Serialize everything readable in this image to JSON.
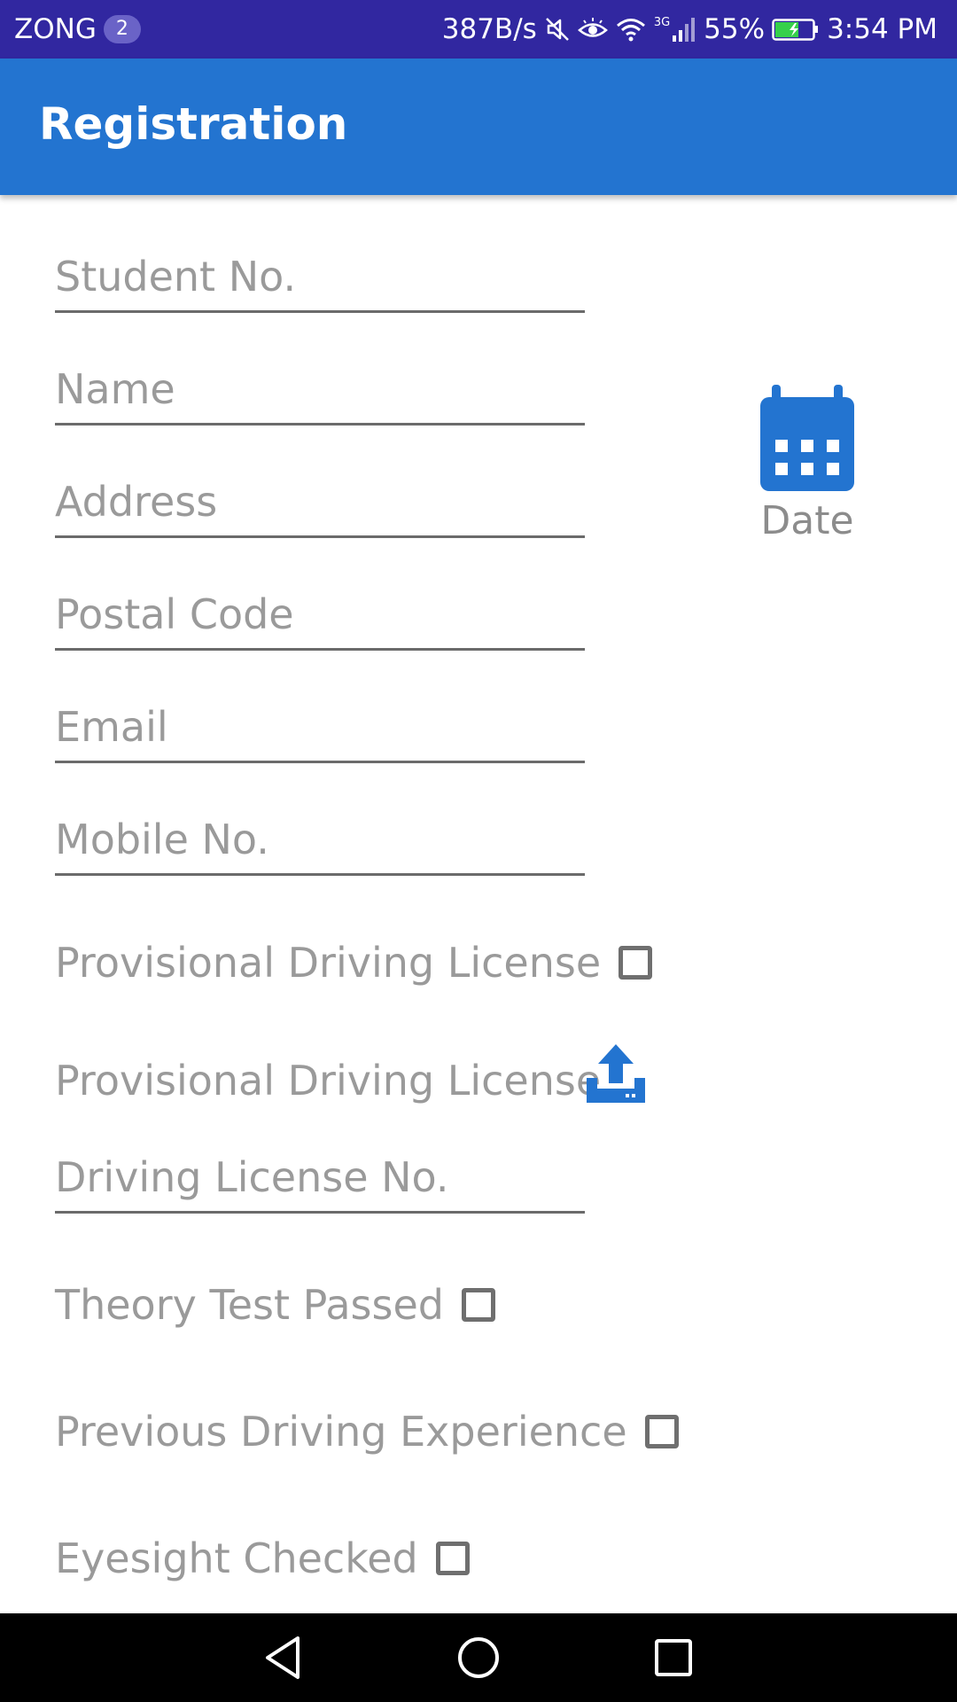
{
  "status_bar": {
    "carrier": "ZONG",
    "sim_slot": "2",
    "net_speed": "387B/s",
    "network_type": "3G",
    "battery": "55%",
    "time": "3:54 PM",
    "icons": [
      "mute-icon",
      "eye-comfort-icon",
      "wifi-icon",
      "signal-icon",
      "battery-charging-icon"
    ]
  },
  "app_bar": {
    "title": "Registration"
  },
  "form": {
    "student_no": {
      "placeholder": "Student No.",
      "value": ""
    },
    "name": {
      "placeholder": "Name",
      "value": ""
    },
    "address": {
      "placeholder": "Address",
      "value": ""
    },
    "postal_code": {
      "placeholder": "Postal Code",
      "value": ""
    },
    "email": {
      "placeholder": "Email",
      "value": ""
    },
    "mobile_no": {
      "placeholder": "Mobile No.",
      "value": ""
    },
    "provisional_license_check": {
      "label": "Provisional Driving License",
      "checked": false
    },
    "provisional_license_upload": {
      "label": "Provisional Driving License",
      "icon": "upload-icon"
    },
    "driving_license_no": {
      "placeholder": "Driving License No.",
      "value": ""
    },
    "theory_test": {
      "label": "Theory Test Passed",
      "checked": false
    },
    "previous_experience": {
      "label": "Previous Driving Experience",
      "checked": false
    },
    "eyesight": {
      "label": "Eyesight Checked",
      "checked": false
    }
  },
  "date_picker": {
    "label": "Date",
    "icon": "calendar-icon"
  },
  "colors": {
    "status_bar": "#3127a0",
    "app_bar": "#2374d0",
    "accent": "#2374d0",
    "hint_text": "#9a9a9a"
  },
  "nav_bar": {
    "buttons": [
      "back-icon",
      "home-icon",
      "recents-icon"
    ]
  }
}
